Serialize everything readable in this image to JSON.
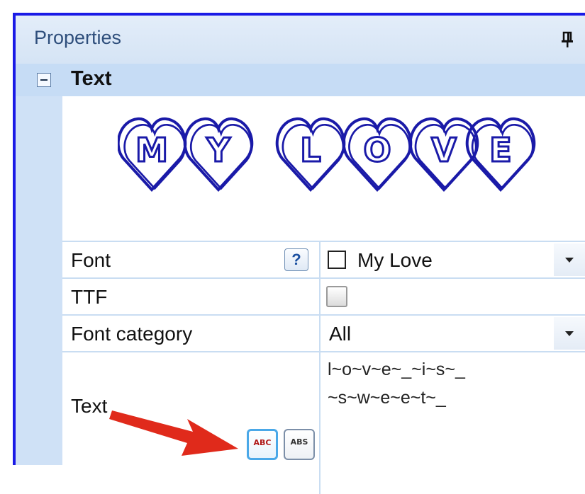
{
  "panel": {
    "title": "Properties",
    "pin_icon": "pin-icon"
  },
  "group": {
    "title": "Text",
    "collapse_icon": "minus-box-icon"
  },
  "preview": {
    "text_letters": [
      "M",
      "Y",
      "L",
      "O",
      "V",
      "E"
    ],
    "stroke_color": "#1a1aa8"
  },
  "properties": {
    "font": {
      "label": "Font",
      "help_label": "?",
      "value": "My Love"
    },
    "ttf": {
      "label": "TTF",
      "checked": false
    },
    "font_category": {
      "label": "Font category",
      "value": "All"
    },
    "text": {
      "label": "Text",
      "value_line1": "l~o~v~e~_~i~s~_",
      "value_line2": "~s~w~e~e~t~_",
      "button1_label": "ABC",
      "button2_label": "ABS"
    }
  },
  "colors": {
    "frame_border": "#1a1ae6",
    "header_bg": "#d5e4f5",
    "accent_arrow": "#e02a1b"
  }
}
